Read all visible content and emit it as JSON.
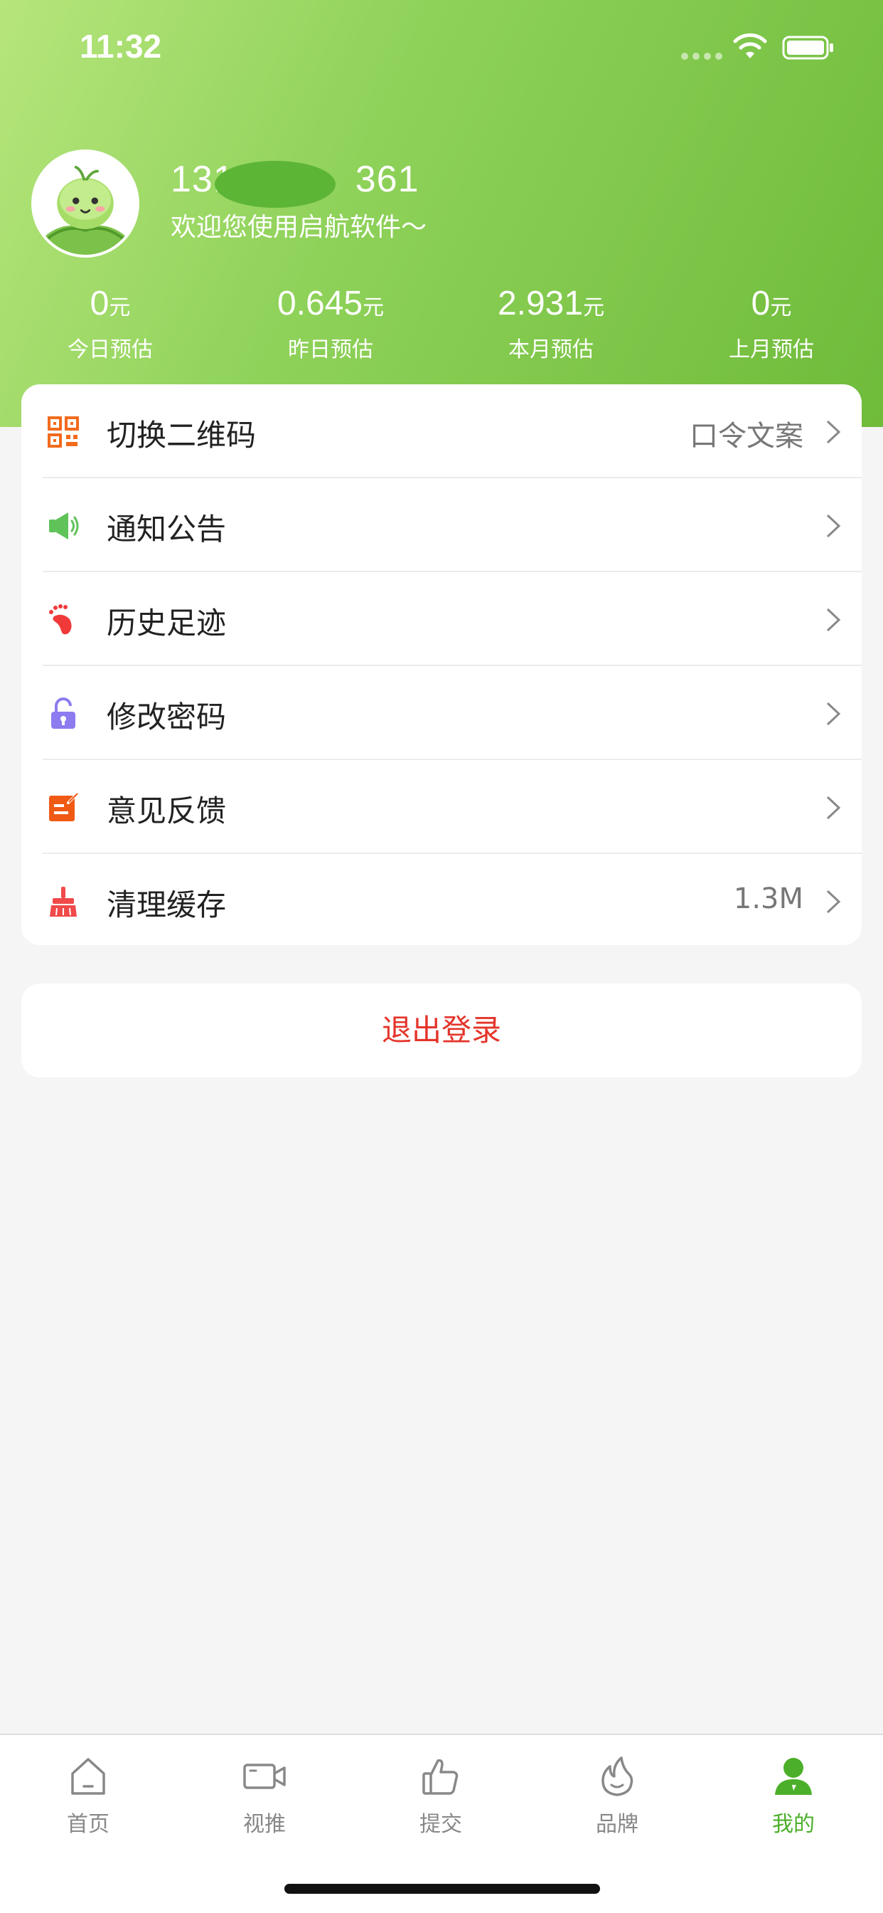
{
  "status_bar": {
    "time": "11:32"
  },
  "profile": {
    "phone_prefix": "131",
    "phone_suffix": "361",
    "welcome": "欢迎您使用启航软件～"
  },
  "stats": [
    {
      "value": "0",
      "unit": "元",
      "label": "今日预估"
    },
    {
      "value": "0.645",
      "unit": "元",
      "label": "昨日预估"
    },
    {
      "value": "2.931",
      "unit": "元",
      "label": "本月预估"
    },
    {
      "value": "0",
      "unit": "元",
      "label": "上月预估"
    }
  ],
  "menu": [
    {
      "label": "切换二维码",
      "value": "口令文案",
      "icon": "qr-code-icon",
      "color": "#f26b1d"
    },
    {
      "label": "通知公告",
      "value": "",
      "icon": "megaphone-icon",
      "color": "#5fc35a"
    },
    {
      "label": "历史足迹",
      "value": "",
      "icon": "footprint-icon",
      "color": "#f03a3a"
    },
    {
      "label": "修改密码",
      "value": "",
      "icon": "lock-icon",
      "color": "#8c7cf0"
    },
    {
      "label": "意见反馈",
      "value": "",
      "icon": "feedback-icon",
      "color": "#f05a14"
    },
    {
      "label": "清理缓存",
      "value": "1.3M",
      "icon": "broom-icon",
      "color": "#f04a4a"
    }
  ],
  "logout_label": "退出登录",
  "tabs": [
    {
      "label": "首页",
      "icon": "home-icon",
      "active": false
    },
    {
      "label": "视推",
      "icon": "video-icon",
      "active": false
    },
    {
      "label": "提交",
      "icon": "thumbs-up-icon",
      "active": false
    },
    {
      "label": "品牌",
      "icon": "flame-icon",
      "active": false
    },
    {
      "label": "我的",
      "icon": "user-icon",
      "active": true
    }
  ],
  "colors": {
    "header_gradient_start": "#b6e57c",
    "header_gradient_end": "#6fbb3a",
    "accent_green": "#4caf2a",
    "logout_red": "#e4342a"
  }
}
